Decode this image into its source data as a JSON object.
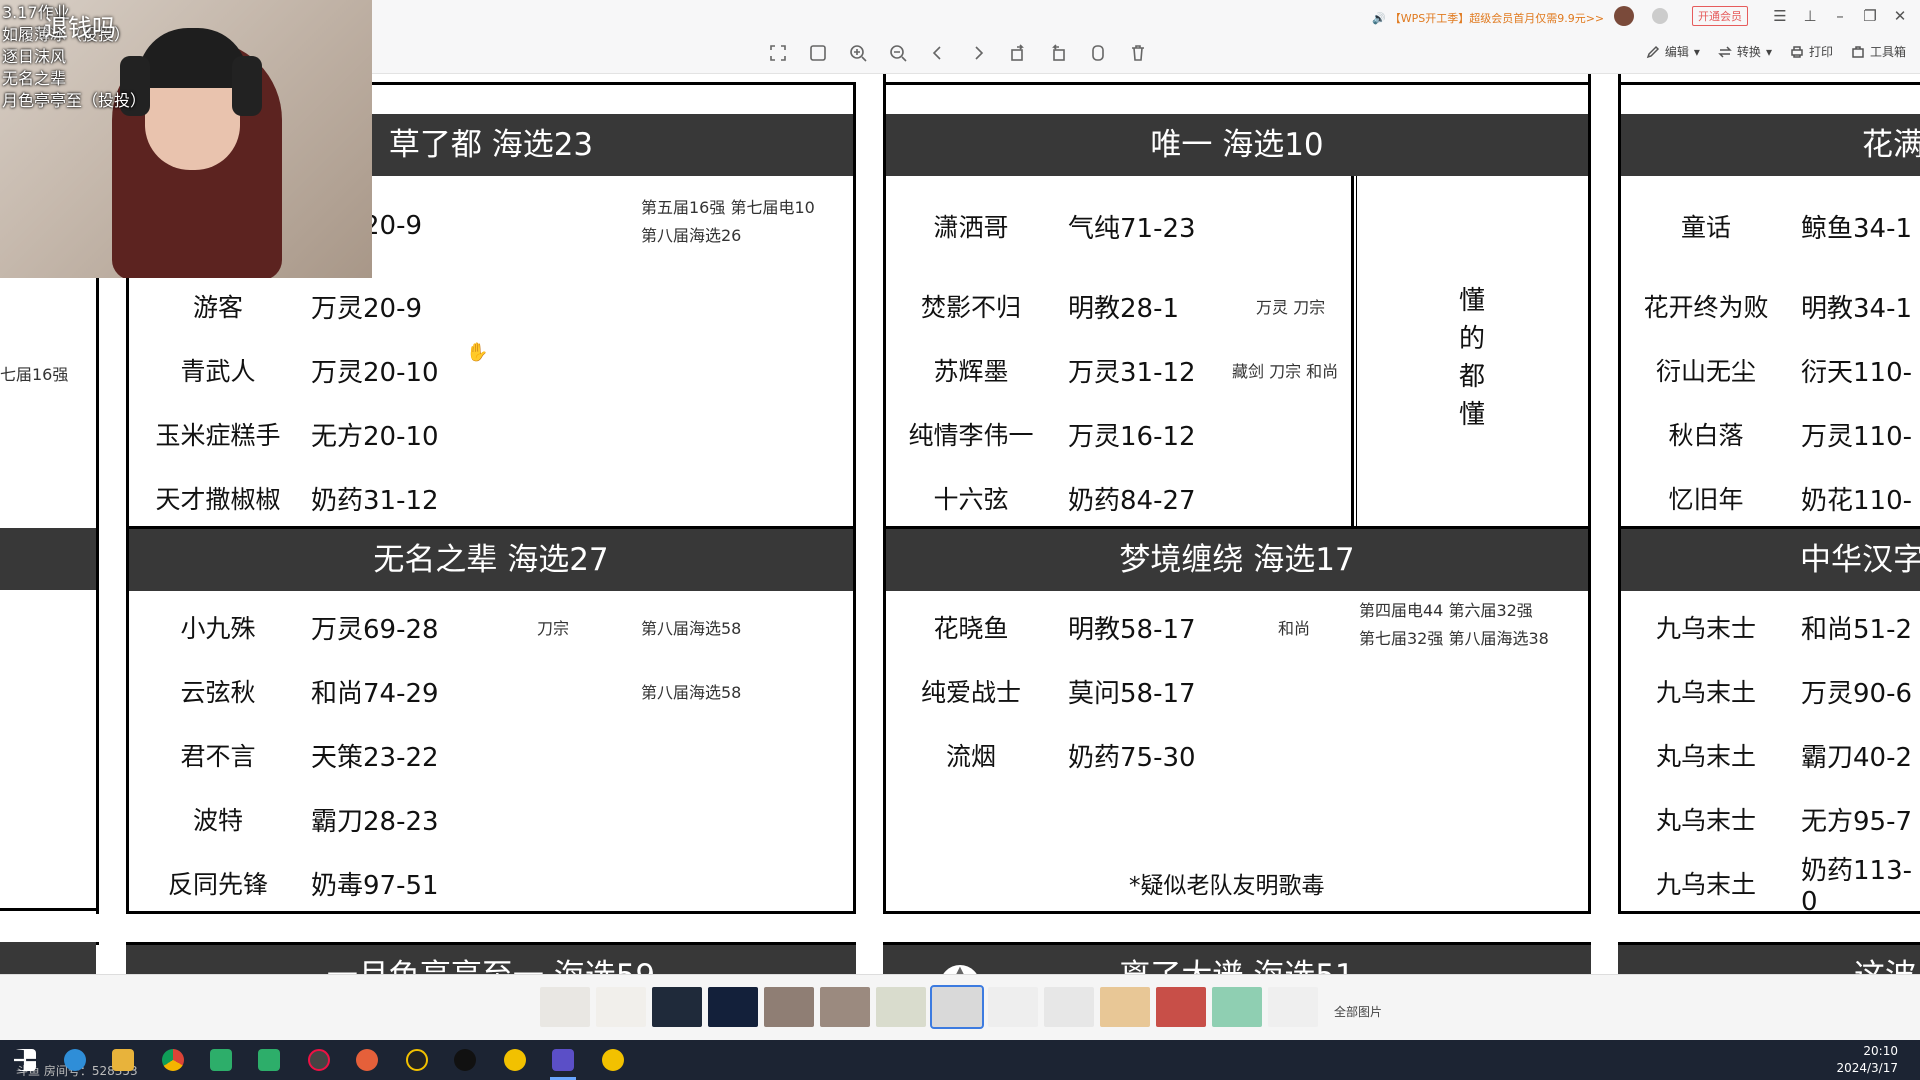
{
  "toolbar": {
    "promo": "【WPS开工季】超级会员首月仅需9.9元>>",
    "vip_button": "开通会员",
    "edit": "编辑",
    "convert": "转换",
    "print": "打印",
    "toolbox": "工具箱"
  },
  "webcam_overlay": {
    "lines": [
      "3.17作业",
      "如履薄冰（投投）",
      "逐日沫风",
      "无名之辈",
      "月色亭亭至（投投）"
    ],
    "watermark": "退钱吗"
  },
  "left_partial": {
    "note": "七届16强"
  },
  "teams": {
    "caoledu": {
      "header": "草了都 海选23",
      "rows": [
        {
          "name": "",
          "class": "20-9",
          "note": "",
          "hist1": "第五届16强 第七届电10",
          "hist2": "第八届海选26"
        },
        {
          "name": "游客",
          "class": "万灵20-9",
          "note": "",
          "hist1": "",
          "hist2": ""
        },
        {
          "name": "青武人",
          "class": "万灵20-10",
          "note": "",
          "hist1": "",
          "hist2": ""
        },
        {
          "name": "玉米症糕手",
          "class": "无方20-10",
          "note": "",
          "hist1": "",
          "hist2": ""
        },
        {
          "name": "天才撒椒椒",
          "class": "奶药31-12",
          "note": "",
          "hist1": "",
          "hist2": ""
        }
      ]
    },
    "wuming": {
      "header": "无名之辈 海选27",
      "rows": [
        {
          "name": "小九殊",
          "class": "万灵69-28",
          "note": "刀宗",
          "hist1": "第八届海选58"
        },
        {
          "name": "云弦秋",
          "class": "和尚74-29",
          "note": "",
          "hist1": "第八届海选58"
        },
        {
          "name": "君不言",
          "class": "天策23-22",
          "note": "",
          "hist1": ""
        },
        {
          "name": "波特",
          "class": "霸刀28-23",
          "note": "",
          "hist1": ""
        },
        {
          "name": "反同先锋",
          "class": "奶毒97-51",
          "note": "",
          "hist1": ""
        }
      ]
    },
    "weiyi": {
      "header": "唯一 海选10",
      "rows": [
        {
          "name": "潇洒哥",
          "class": "气纯71-23",
          "note": ""
        },
        {
          "name": "焚影不归",
          "class": "明教28-1",
          "note": "万灵 刀宗"
        },
        {
          "name": "苏辉墨",
          "class": "万灵31-12",
          "note": "藏剑 刀宗 和尚"
        },
        {
          "name": "纯情李伟一",
          "class": "万灵16-12",
          "note": ""
        },
        {
          "name": "十六弦",
          "class": "奶药84-27",
          "note": ""
        }
      ],
      "side_note": [
        "懂",
        "的",
        "都",
        "懂"
      ]
    },
    "mengjing": {
      "header": "梦境缠绕 海选17",
      "rows": [
        {
          "name": "花晓鱼",
          "class": "明教58-17",
          "note": "和尚",
          "hist1": "第四届电44 第六届32强",
          "hist2": "第七届32强 第八届海选38"
        },
        {
          "name": "纯爱战士",
          "class": "莫问58-17",
          "note": "",
          "hist1": "",
          "hist2": ""
        },
        {
          "name": "流烟",
          "class": "奶药75-30",
          "note": "",
          "hist1": "",
          "hist2": ""
        }
      ],
      "footnote": "*疑似老队友明歌毒"
    },
    "huaman": {
      "header": "花满",
      "rows": [
        {
          "name": "童话",
          "class": "鲸鱼34-1"
        },
        {
          "name": "花开终为败",
          "class": "明教34-1"
        },
        {
          "name": "衍山无尘",
          "class": "衍天110-"
        },
        {
          "name": "秋白落",
          "class": "万灵110-"
        },
        {
          "name": "忆旧年",
          "class": "奶花110-"
        }
      ]
    },
    "zhonghua": {
      "header": "中华汉字",
      "rows": [
        {
          "name": "九乌末士",
          "class": "和尚51-2"
        },
        {
          "name": "九乌末土",
          "class": "万灵90-6"
        },
        {
          "name": "丸乌末土",
          "class": "霸刀40-2"
        },
        {
          "name": "丸乌末士",
          "class": "无方95-7"
        },
        {
          "name": "九乌末土",
          "class": "奶药113-0"
        }
      ]
    },
    "bottom_partials": [
      "一月色亭亭至一 海选59",
      "离了大谱 海选51",
      "这波"
    ]
  },
  "thumbnails": {
    "all_pictures_label": "全部图片",
    "count": 14,
    "selected_index": 7
  },
  "taskbar": {
    "room": "斗鱼 房间号：528353",
    "time": "20:10",
    "date": "2024/3/17"
  }
}
